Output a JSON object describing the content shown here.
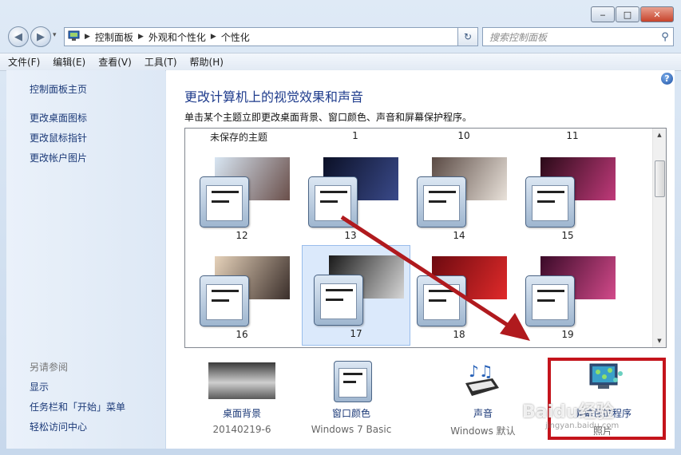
{
  "window": {
    "minimize": "‒",
    "maximize": "□",
    "close": "✕"
  },
  "nav": {
    "back": "◀",
    "forward": "▶",
    "history": "▾"
  },
  "address": {
    "crumbs": [
      "控制面板",
      "外观和个性化",
      "个性化"
    ],
    "dropdown": "▾",
    "refresh": "↻"
  },
  "search": {
    "placeholder": "搜索控制面板",
    "icon": "search-icon"
  },
  "menu": [
    "文件(F)",
    "编辑(E)",
    "查看(V)",
    "工具(T)",
    "帮助(H)"
  ],
  "sidebar": {
    "links": [
      "控制面板主页",
      "更改桌面图标",
      "更改鼠标指针",
      "更改帐户图片"
    ],
    "see_also": "另请参阅",
    "related": [
      "显示",
      "任务栏和「开始」菜单",
      "轻松访问中心"
    ]
  },
  "main": {
    "help": "?",
    "title": "更改计算机上的视觉效果和声音",
    "subtitle": "单击某个主题立即更改桌面背景、窗口颜色、声音和屏幕保护程序。",
    "top_labels": [
      "未保存的主题",
      "1",
      "10",
      "11"
    ],
    "themes": [
      {
        "name": "12",
        "colors": [
          "#d8e6f3",
          "#6a4f4a"
        ]
      },
      {
        "name": "13",
        "colors": [
          "#0b1026",
          "#3a4a8a"
        ]
      },
      {
        "name": "14",
        "colors": [
          "#5a4a44",
          "#e9e2da"
        ]
      },
      {
        "name": "15",
        "colors": [
          "#2a0a18",
          "#c03a7a"
        ]
      },
      {
        "name": "16",
        "colors": [
          "#e6d2ba",
          "#3a2e2a"
        ]
      },
      {
        "name": "17",
        "colors": [
          "#1a1a1a",
          "#d6d6d6"
        ],
        "selected": true
      },
      {
        "name": "18",
        "colors": [
          "#6d0a10",
          "#e02a2a"
        ]
      },
      {
        "name": "19",
        "colors": [
          "#3a0a28",
          "#d24a8a"
        ]
      }
    ]
  },
  "bottom": [
    {
      "label": "桌面背景",
      "value": "20140219-6"
    },
    {
      "label": "窗口颜色",
      "value": "Windows 7 Basic"
    },
    {
      "label": "声音",
      "value": "Windows 默认"
    },
    {
      "label": "屏幕保护程序",
      "value": "照片"
    }
  ],
  "watermark": {
    "main": "Baidu经验",
    "sub": "jingyan.baidu.com"
  },
  "colors": {
    "annotation_red": "#c4141c",
    "link": "#1c3a78",
    "title": "#1e3b8c"
  }
}
